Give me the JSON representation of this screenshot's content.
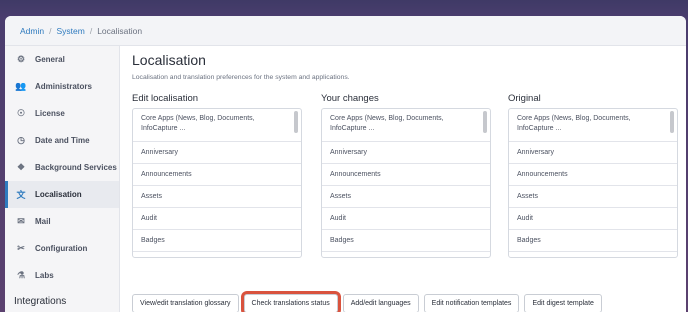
{
  "breadcrumb": {
    "items": [
      "Admin",
      "System"
    ],
    "current": "Localisation"
  },
  "sidebar": {
    "items": [
      {
        "label": "General",
        "icon": "gears-icon",
        "glyph": "⚙"
      },
      {
        "label": "Administrators",
        "icon": "users-icon",
        "glyph": "👥"
      },
      {
        "label": "License",
        "icon": "badge-icon",
        "glyph": "☉"
      },
      {
        "label": "Date and Time",
        "icon": "clock-icon",
        "glyph": "◷"
      },
      {
        "label": "Background Services",
        "icon": "services-icon",
        "glyph": "❖"
      },
      {
        "label": "Localisation",
        "icon": "translate-icon",
        "glyph": "文"
      },
      {
        "label": "Mail",
        "icon": "mail-icon",
        "glyph": "✉"
      },
      {
        "label": "Configuration",
        "icon": "tools-icon",
        "glyph": "✂"
      },
      {
        "label": "Labs",
        "icon": "flask-icon",
        "glyph": "⚗"
      }
    ],
    "active_index": 5,
    "section_heading": "Integrations"
  },
  "main": {
    "title": "Localisation",
    "subtitle": "Localisation and translation preferences for the system and applications."
  },
  "columns": [
    {
      "heading": "Edit localisation",
      "rows": [
        "Core Apps (News, Blog, Documents, InfoCapture ...",
        "Anniversary",
        "Announcements",
        "Assets",
        "Audit",
        "Badges"
      ]
    },
    {
      "heading": "Your changes",
      "rows": [
        "Core Apps (News, Blog, Documents, InfoCapture ...",
        "Anniversary",
        "Announcements",
        "Assets",
        "Audit",
        "Badges"
      ]
    },
    {
      "heading": "Original",
      "rows": [
        "Core Apps (News, Blog, Documents, InfoCapture ...",
        "Anniversary",
        "Announcements",
        "Assets",
        "Audit",
        "Badges"
      ]
    }
  ],
  "buttons": [
    {
      "label": "View/edit translation glossary",
      "highlighted": false
    },
    {
      "label": "Check translations status",
      "highlighted": true
    },
    {
      "label": "Add/edit languages",
      "highlighted": false
    },
    {
      "label": "Edit notification templates",
      "highlighted": false
    },
    {
      "label": "Edit digest template",
      "highlighted": false
    }
  ],
  "colors": {
    "accent": "#2f7bbf",
    "highlight": "#d9533e"
  }
}
